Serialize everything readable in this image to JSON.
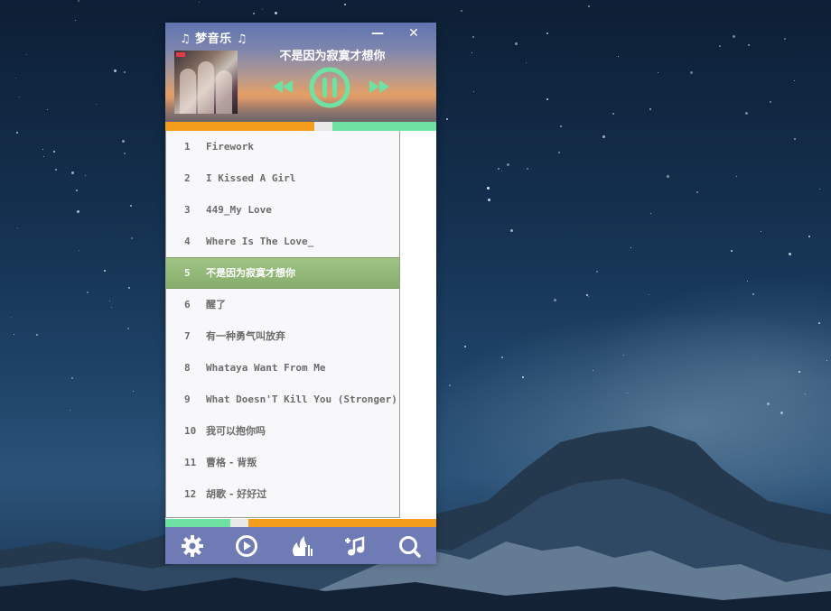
{
  "app": {
    "title": "♫ 梦音乐 ♫",
    "minimize": "—",
    "close": "✕"
  },
  "now_playing": {
    "title": "不是因为寂寞才想你",
    "state": "playing",
    "progress": 0.55
  },
  "playlist": [
    {
      "num": "1",
      "title": "Firework"
    },
    {
      "num": "2",
      "title": "I Kissed A Girl"
    },
    {
      "num": "3",
      "title": "449_My Love"
    },
    {
      "num": "4",
      "title": "Where Is The Love_"
    },
    {
      "num": "5",
      "title": "不是因为寂寞才想你"
    },
    {
      "num": "6",
      "title": "醒了"
    },
    {
      "num": "7",
      "title": "有一种勇气叫放弃"
    },
    {
      "num": "8",
      "title": "Whataya Want From Me"
    },
    {
      "num": "9",
      "title": "What Doesn'T Kill You (Stronger)"
    },
    {
      "num": "10",
      "title": "我可以抱你吗"
    },
    {
      "num": "11",
      "title": "曹格 - 背叛"
    },
    {
      "num": "12",
      "title": "胡歌 - 好好过"
    }
  ],
  "active_index": 4,
  "toolbar": {
    "icons": [
      "gear-icon",
      "play-circle-icon",
      "flame-icon",
      "add-music-icon",
      "search-icon"
    ]
  },
  "colors": {
    "accent_green": "#6ee2a3",
    "accent_orange": "#f49c1b",
    "toolbar": "#6f7bb4",
    "active_row": "#94b87a"
  }
}
